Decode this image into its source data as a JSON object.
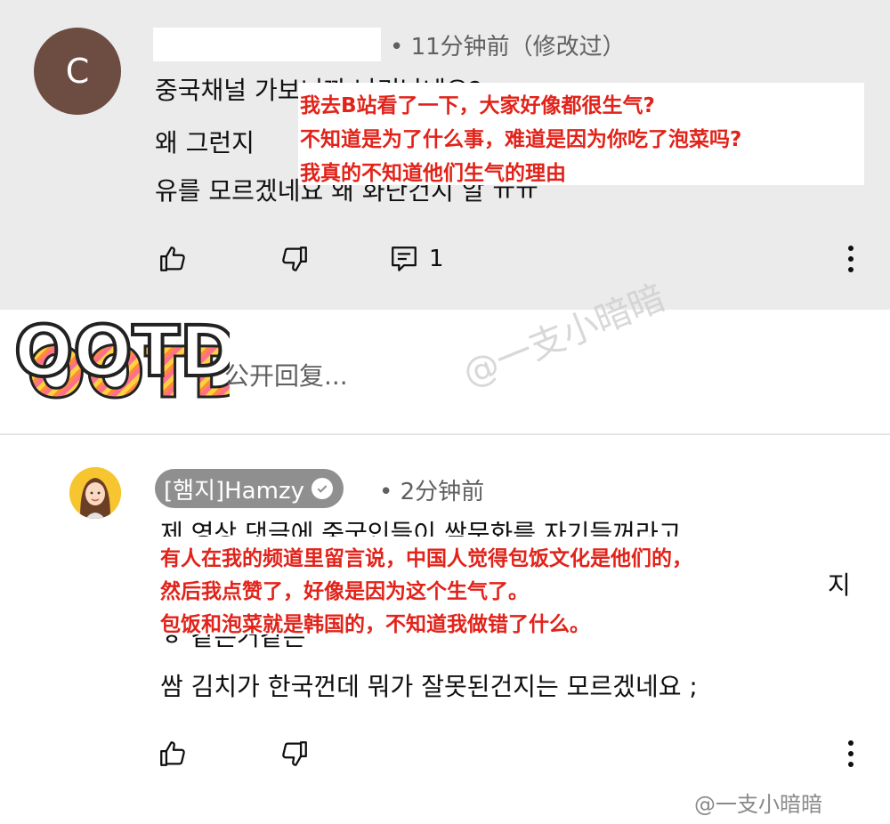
{
  "top_comment": {
    "avatar_letter": "C",
    "meta": "• 11分钟前（修改过）",
    "lines": [
      "중국채널 가보니까 난리났네요?",
      "왜 그런지 ",
      "유를 모르겠네요 왜 화난건지 알 ㅠㅠ"
    ],
    "translation": [
      "我去B站看了一下，大家好像都很生气?",
      "不知道是为了什么事，难道是因为你吃了泡菜吗?",
      "我真的不知道他们生气的理由"
    ],
    "reply_count": "1",
    "icons": [
      "thumb-up-icon",
      "thumb-down-icon",
      "reply-icon",
      "more-vertical-icon"
    ]
  },
  "reply_box": {
    "sticker_text": "OOTD",
    "placeholder": "公开回复..."
  },
  "watermark_center": "@一支小暗暗",
  "reply_comment": {
    "author": "[햄지]Hamzy",
    "meta": "• 2分钟前",
    "lines": [
      "제 영상 댓글에  중국인들이 쌈문화를 자기들꺼라고",
      "지",
      "ㅎ 같은거같은",
      "쌈 김치가 한국껀데 뭐가 잘못된건지는 모르겠네요 ;"
    ],
    "translation": [
      "有人在我的频道里留言说，中国人觉得包饭文化是他们的，",
      "然后我点赞了，好像是因为这个生气了。",
      "包饭和泡菜就是韩国的，不知道我做错了什么。"
    ],
    "icons": [
      "thumb-up-icon",
      "thumb-down-icon",
      "more-vertical-icon",
      "verified-check-icon"
    ]
  },
  "watermark_br": "@一支小暗暗",
  "colors": {
    "top_bg": "#ebebeb",
    "avatar": "#6d4c41",
    "translation_red": "#e1231a",
    "pill": "#8f8f8f"
  }
}
